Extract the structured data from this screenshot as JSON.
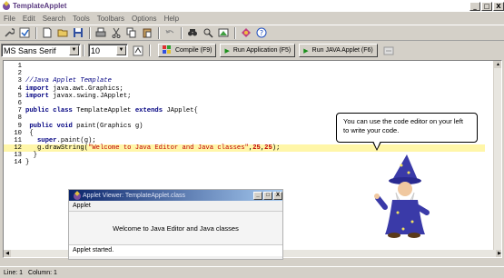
{
  "window": {
    "title": "TemplateApplet",
    "controls": [
      "_",
      "□",
      "X"
    ]
  },
  "menu": [
    "File",
    "Edit",
    "Search",
    "Tools",
    "Toolbars",
    "Options",
    "Help"
  ],
  "toolbar2": {
    "font_family": "MS Sans Serif",
    "font_size": "10",
    "compile_label": "Compile  (F9)",
    "run_app_label": "Run Application (F5)",
    "run_applet_label": "Run JAVA Applet (F6)"
  },
  "editor": {
    "lines": [
      {
        "n": "1",
        "text": ""
      },
      {
        "n": "2",
        "text": ""
      },
      {
        "n": "3",
        "text": "//Java Applet Template"
      },
      {
        "n": "4",
        "text": "import java.awt.Graphics;"
      },
      {
        "n": "5",
        "text": "import javax.swing.JApplet;"
      },
      {
        "n": "6",
        "text": ""
      },
      {
        "n": "7",
        "text": "public class TemplateApplet extends JApplet{"
      },
      {
        "n": "8",
        "text": ""
      },
      {
        "n": "9",
        "text": " public void paint(Graphics g)"
      },
      {
        "n": "10",
        "text": " {"
      },
      {
        "n": "11",
        "text": "   super.paint(g);"
      },
      {
        "n": "12",
        "text": "   g.drawString(\"Welcome to Java Editor and Java classes\",25,25);"
      },
      {
        "n": "13",
        "text": "  }"
      },
      {
        "n": "14",
        "text": "}"
      }
    ],
    "highlight_line": 12
  },
  "applet_viewer": {
    "title": "Applet Viewer: TemplateApplet.class",
    "menu": "Applet",
    "message": "Welcome to Java Editor and Java classes",
    "status": "Applet started."
  },
  "bubble": {
    "text": "You can use the code editor on your left to write your code."
  },
  "statusbar": {
    "line": "Line: 1",
    "column": "Column: 1"
  },
  "colors": {
    "keyword": "#000080",
    "string": "#c00000",
    "highlight": "#fff6a8",
    "applet_title": "#0a246a"
  }
}
